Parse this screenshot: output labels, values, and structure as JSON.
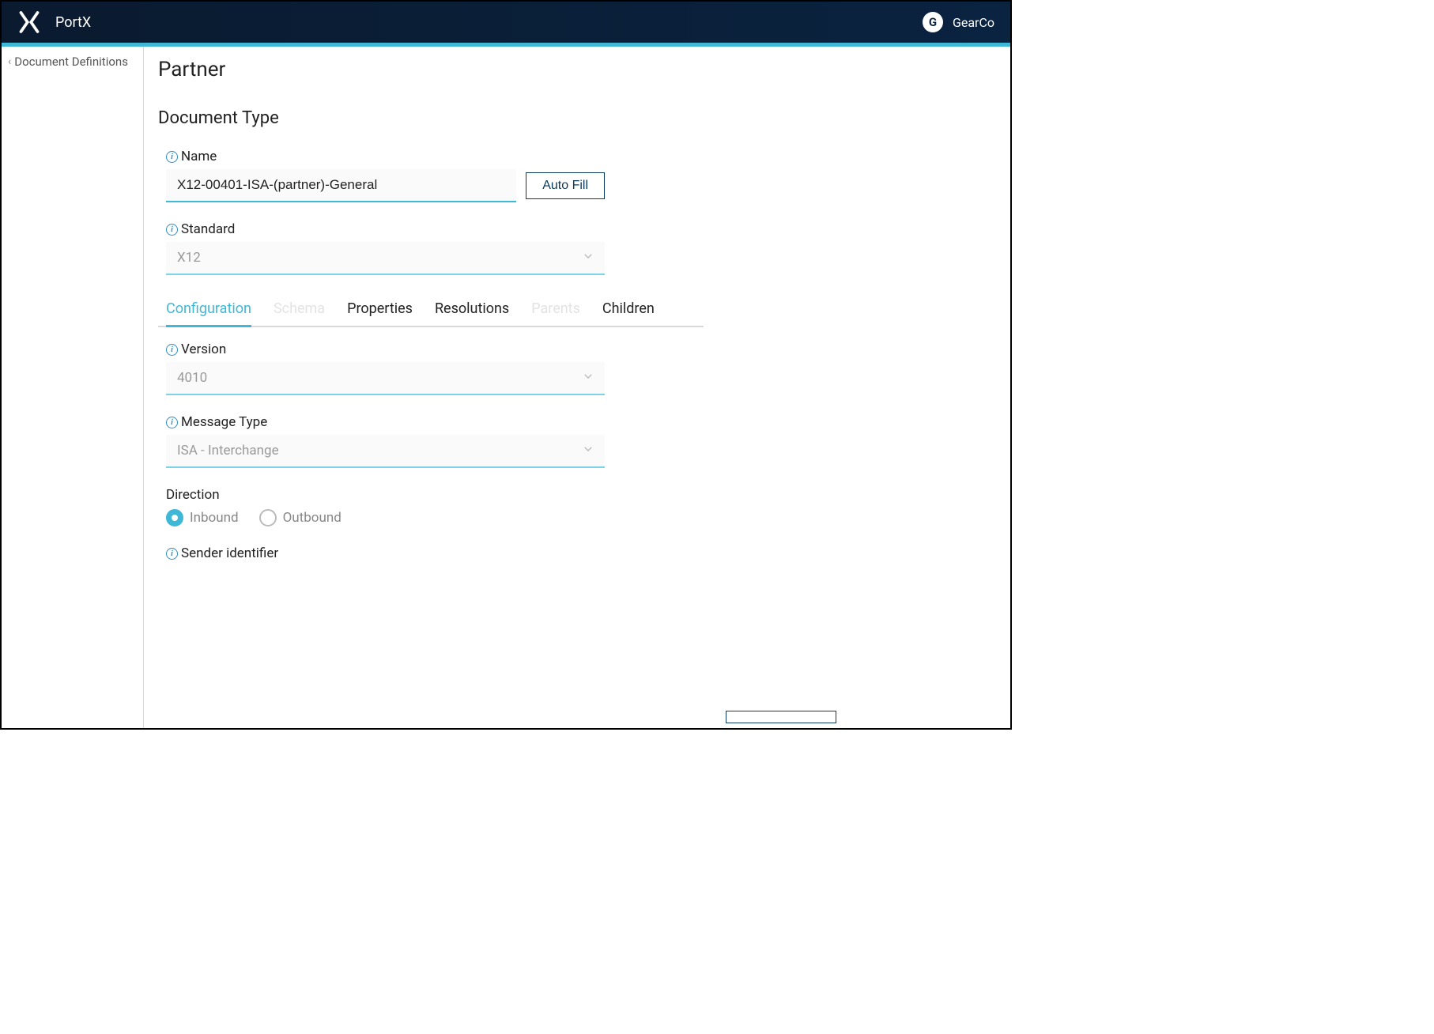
{
  "header": {
    "app_name": "PortX",
    "avatar_initial": "G",
    "org_name": "GearCo"
  },
  "sidebar": {
    "back_label": "Document Definitions"
  },
  "page": {
    "title": "Partner",
    "section_title": "Document Type"
  },
  "fields": {
    "name": {
      "label": "Name",
      "value": "X12-00401-ISA-(partner)-General",
      "auto_fill_label": "Auto Fill"
    },
    "standard": {
      "label": "Standard",
      "value": "X12"
    },
    "version": {
      "label": "Version",
      "value": "4010"
    },
    "message_type": {
      "label": "Message Type",
      "value": "ISA - Interchange"
    },
    "direction": {
      "label": "Direction",
      "options": {
        "inbound": "Inbound",
        "outbound": "Outbound"
      },
      "selected": "inbound"
    },
    "sender_identifier": {
      "label": "Sender identifier"
    }
  },
  "tabs": [
    {
      "label": "Configuration",
      "state": "active"
    },
    {
      "label": "Schema",
      "state": "disabled"
    },
    {
      "label": "Properties",
      "state": "normal"
    },
    {
      "label": "Resolutions",
      "state": "normal"
    },
    {
      "label": "Parents",
      "state": "disabled"
    },
    {
      "label": "Children",
      "state": "normal"
    }
  ]
}
